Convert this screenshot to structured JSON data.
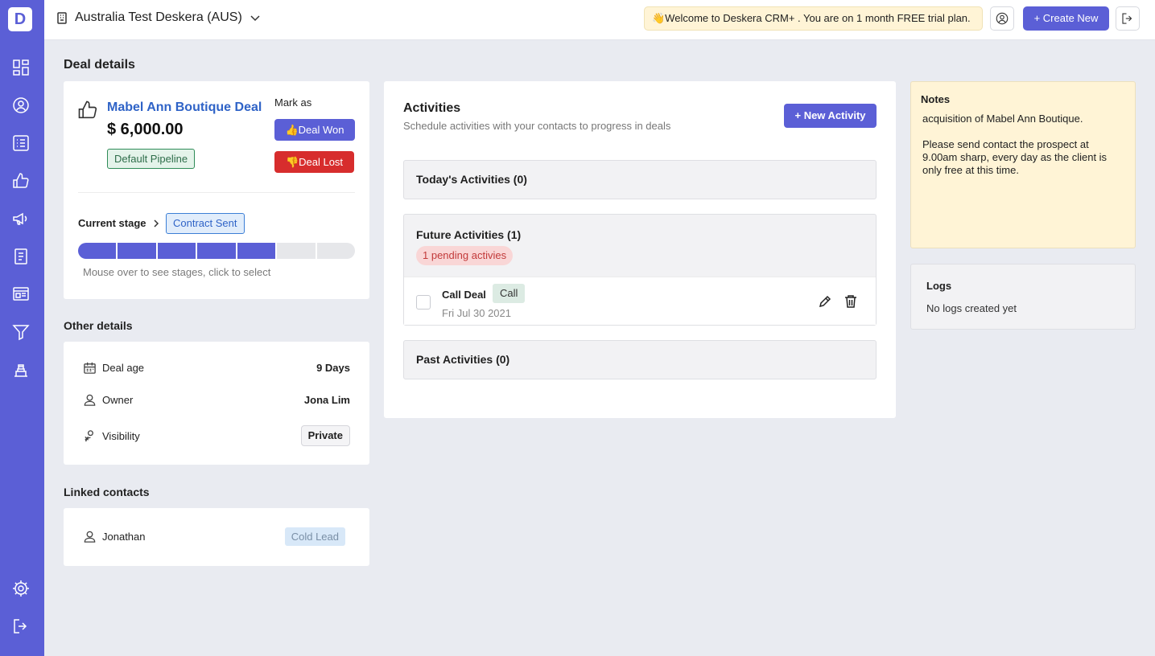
{
  "brand": {
    "logo_letter": "D",
    "accent": "#5b5fd6"
  },
  "sidebar": {
    "items": [
      {
        "icon": "dashboard-icon"
      },
      {
        "icon": "contacts-icon"
      },
      {
        "icon": "list-icon"
      },
      {
        "icon": "deals-thumb-icon"
      },
      {
        "icon": "campaign-megaphone-icon"
      },
      {
        "icon": "forms-clipboard-icon"
      },
      {
        "icon": "landing-page-icon"
      },
      {
        "icon": "funnel-icon"
      },
      {
        "icon": "helpdesk-icon"
      },
      {
        "icon": "settings-gear-icon"
      },
      {
        "icon": "logout-icon"
      }
    ]
  },
  "topbar": {
    "org_name": "Australia Test Deskera (AUS)",
    "welcome": "👋Welcome to Deskera CRM+ . You are on 1 month FREE trial plan.",
    "create_new": "+ Create New"
  },
  "page": {
    "title": "Deal details"
  },
  "deal": {
    "name": "Mabel Ann Boutique Deal",
    "amount": "$ 6,000.00",
    "pipeline": "Default Pipeline",
    "mark_as": "Mark as",
    "won_label": "👍Deal Won",
    "lost_label": "👎Deal Lost",
    "current_stage_label": "Current stage",
    "current_stage": "Contract Sent",
    "stages_total": 7,
    "stages_completed": 5,
    "stage_hint": "Mouse over to see stages, click to select"
  },
  "other_details": {
    "title": "Other details",
    "rows": [
      {
        "icon": "calendar-age-icon",
        "label": "Deal age",
        "value": "9 Days"
      },
      {
        "icon": "owner-user-icon",
        "label": "Owner",
        "value": "Jona Lim"
      },
      {
        "icon": "visibility-icon",
        "label": "Visibility",
        "value": "Private"
      }
    ]
  },
  "linked_contacts": {
    "title": "Linked contacts",
    "items": [
      {
        "name": "Jonathan",
        "status": "Cold Lead"
      }
    ]
  },
  "activities": {
    "title": "Activities",
    "subtitle": "Schedule activities with your contacts to progress in deals",
    "new_button": "+ New Activity",
    "today": "Today's Activities (0)",
    "future": "Future Activities (1)",
    "pending": "1 pending activies",
    "past": "Past Activities (0)",
    "items": [
      {
        "name": "Call Deal",
        "type": "Call",
        "date": "Fri Jul 30 2021"
      }
    ]
  },
  "notes": {
    "title": "Notes",
    "body": "acquisition of Mabel Ann Boutique.\n\nPlease send contact the prospect at 9.00am sharp, every day as the client is only free at this time."
  },
  "logs": {
    "title": "Logs",
    "empty": "No logs created yet"
  }
}
